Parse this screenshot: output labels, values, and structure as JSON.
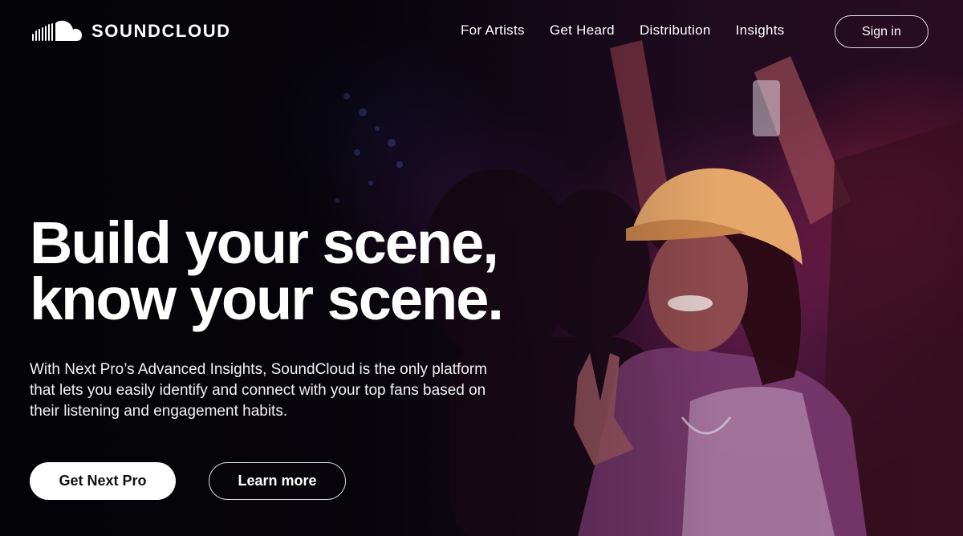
{
  "brand": {
    "name": "SOUNDCLOUD",
    "logo_icon": "soundcloud-cloud-icon"
  },
  "nav": {
    "items": [
      {
        "label": "For Artists"
      },
      {
        "label": "Get Heard"
      },
      {
        "label": "Distribution"
      },
      {
        "label": "Insights"
      }
    ],
    "signin_label": "Sign in"
  },
  "hero": {
    "headline_line1": "Build your scene,",
    "headline_line2": "know your scene.",
    "subtext": "With Next Pro’s Advanced Insights, SoundCloud is the only platform that lets you easily identify and connect with your top fans based on their listening and engagement habits.",
    "primary_cta": "Get Next Pro",
    "secondary_cta": "Learn more",
    "background": "concert-crowd-photo"
  },
  "colors": {
    "background": "#050308",
    "text": "#ffffff",
    "primary_button_bg": "#ffffff",
    "primary_button_text": "#111111"
  }
}
